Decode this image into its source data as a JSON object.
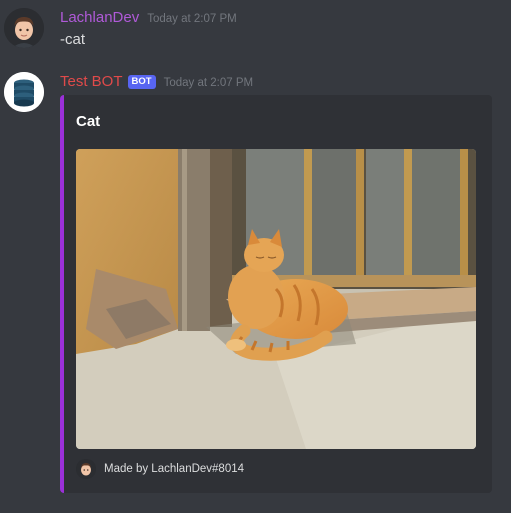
{
  "messages": [
    {
      "author": "LachlanDev",
      "timestamp": "Today at 2:07 PM",
      "content": "-cat"
    },
    {
      "author": "Test BOT",
      "badge": "BOT",
      "timestamp": "Today at 2:07 PM",
      "embed": {
        "title": "Cat",
        "accent_color": "#9b30d9",
        "image_subject": "orange tabby cat sleeping in a sunny doorway",
        "footer_text": "Made by LachlanDev#8014"
      }
    }
  ],
  "colors": {
    "background": "#36393f",
    "embed_background": "#2f3136",
    "dev_name": "#b05ad8",
    "bot_name": "#e04a4a",
    "bot_badge": "#5865f2"
  },
  "icons": {
    "dev_avatar": "memoji-avatar-icon",
    "bot_avatar": "stacked-database-icon"
  }
}
